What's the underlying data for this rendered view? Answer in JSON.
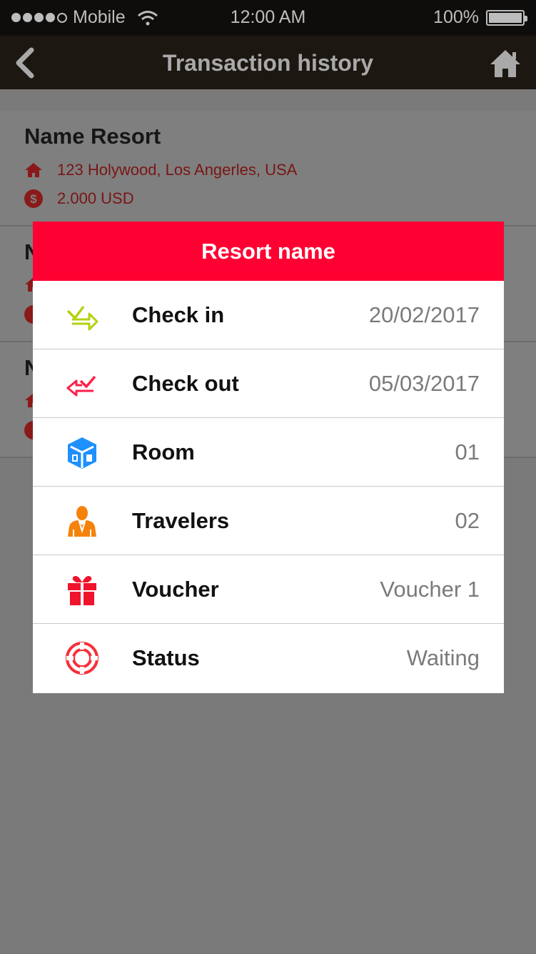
{
  "status_bar": {
    "carrier": "Mobile",
    "time": "12:00 AM",
    "battery": "100%"
  },
  "nav": {
    "title": "Transaction history",
    "back_icon": "back-chevron-icon",
    "home_icon": "home-icon"
  },
  "list": {
    "items": [
      {
        "name": "Name Resort",
        "address": "123 Holywood, Los Angerles, USA",
        "price": "2.000 USD"
      },
      {
        "name": "N",
        "address": "",
        "price": ""
      },
      {
        "name": "N",
        "address": "",
        "price": ""
      }
    ]
  },
  "modal": {
    "title": "Resort name",
    "rows": [
      {
        "icon": "check-in-icon",
        "label": "Check in",
        "value": "20/02/2017"
      },
      {
        "icon": "check-out-icon",
        "label": "Check out",
        "value": "05/03/2017"
      },
      {
        "icon": "room-icon",
        "label": "Room",
        "value": "01"
      },
      {
        "icon": "travelers-icon",
        "label": "Travelers",
        "value": "02"
      },
      {
        "icon": "voucher-icon",
        "label": "Voucher",
        "value": "Voucher 1"
      },
      {
        "icon": "status-icon",
        "label": "Status",
        "value": "Waiting"
      }
    ]
  },
  "colors": {
    "header_red": "#ff0033",
    "check_in": "#b5d10e",
    "check_out": "#ff1f4a",
    "room": "#1e90ff",
    "travelers": "#f5820b",
    "voucher": "#f0132c",
    "status": "#f5303a"
  }
}
